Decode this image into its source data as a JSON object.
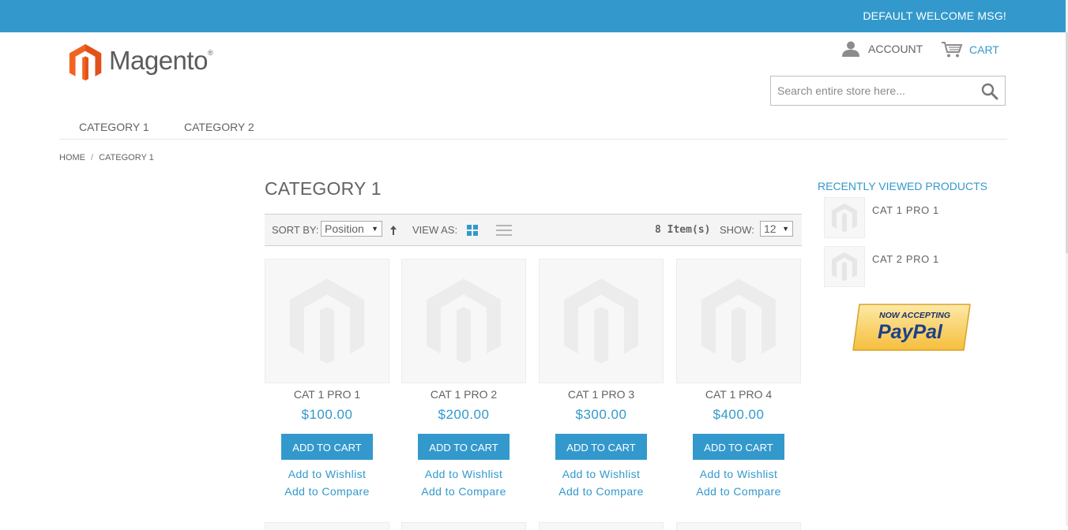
{
  "header": {
    "welcome": "DEFAULT WELCOME MSG!",
    "logo_text": "Magento",
    "logo_reg": "®",
    "account_label": "ACCOUNT",
    "cart_label": "CART",
    "search_placeholder": "Search entire store here..."
  },
  "nav": {
    "items": [
      {
        "label": "CATEGORY 1"
      },
      {
        "label": "CATEGORY 2"
      }
    ]
  },
  "breadcrumb": {
    "home": "HOME",
    "separator": "/",
    "current": "CATEGORY 1"
  },
  "page": {
    "title": "CATEGORY 1"
  },
  "toolbar": {
    "sort_label": "SORT BY:",
    "sort_value": "Position",
    "view_label": "VIEW AS:",
    "items_count": "8 Item(s)",
    "show_label": "SHOW:",
    "show_value": "12"
  },
  "products": [
    {
      "name": "CAT 1 PRO 1",
      "price": "$100.00",
      "add_to_cart": "ADD TO CART",
      "wishlist": "Add to Wishlist",
      "compare": "Add to Compare"
    },
    {
      "name": "CAT 1 PRO 2",
      "price": "$200.00",
      "add_to_cart": "ADD TO CART",
      "wishlist": "Add to Wishlist",
      "compare": "Add to Compare"
    },
    {
      "name": "CAT 1 PRO 3",
      "price": "$300.00",
      "add_to_cart": "ADD TO CART",
      "wishlist": "Add to Wishlist",
      "compare": "Add to Compare"
    },
    {
      "name": "CAT 1 PRO 4",
      "price": "$400.00",
      "add_to_cart": "ADD TO CART",
      "wishlist": "Add to Wishlist",
      "compare": "Add to Compare"
    }
  ],
  "sidebar": {
    "recently_viewed_title": "RECENTLY VIEWED PRODUCTS",
    "recently_viewed": [
      {
        "name": "CAT 1 PRO 1"
      },
      {
        "name": "CAT 2 PRO 1"
      }
    ],
    "paypal_top": "NOW ACCEPTING",
    "paypal_brand": "PayPal"
  },
  "colors": {
    "accent": "#3399cc",
    "text": "#636363",
    "logo_orange": "#f26322",
    "paypal_gold": "#f7c75a"
  },
  "icons": [
    "magento-logo-icon",
    "account-icon",
    "cart-icon",
    "search-icon",
    "sort-arrow-icon",
    "grid-view-icon",
    "list-view-icon",
    "product-placeholder-icon"
  ]
}
